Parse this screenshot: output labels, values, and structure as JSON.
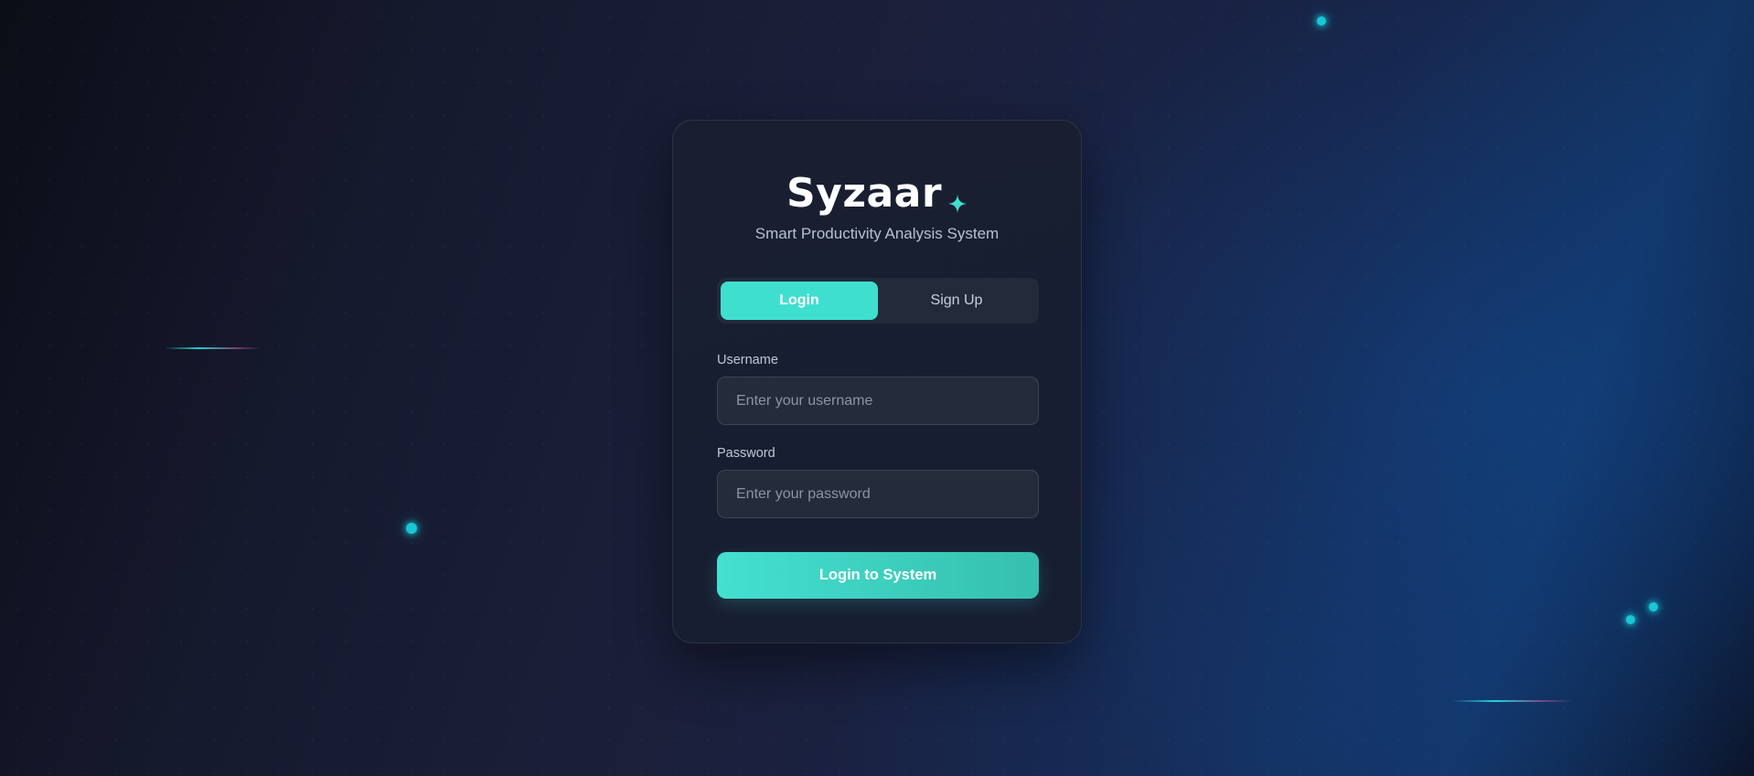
{
  "brand": {
    "name": "Syzaar",
    "subtitle": "Smart Productivity Analysis System",
    "accent_color": "#3fdfcf",
    "star_icon": "sparkle-icon"
  },
  "tabs": [
    {
      "label": "Login",
      "active": true
    },
    {
      "label": "Sign Up",
      "active": false
    }
  ],
  "form": {
    "username_label": "Username",
    "username_placeholder": "Enter your username",
    "username_value": "",
    "password_label": "Password",
    "password_placeholder": "Enter your password",
    "password_value": "",
    "submit_label": "Login to System"
  },
  "colors": {
    "background_dark": "#0b0d17",
    "background_blue": "#123463",
    "card": "#1a1f30",
    "particle": "#19c6d6"
  }
}
